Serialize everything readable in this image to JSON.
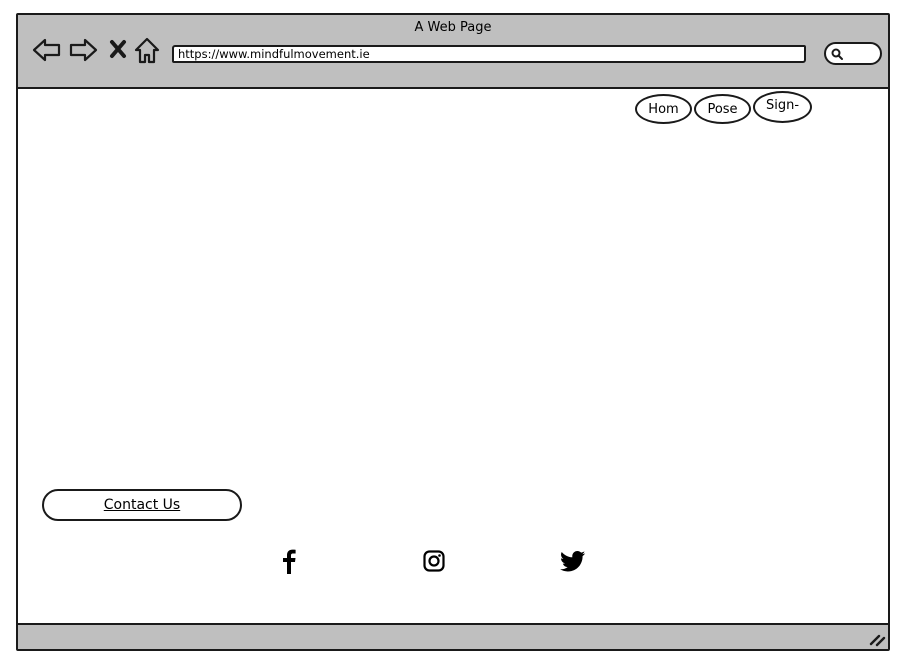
{
  "window": {
    "title": "A Web Page"
  },
  "browser": {
    "url": "https://www.mindfulmovement.ie",
    "icons": [
      "back-arrow-icon",
      "forward-arrow-icon",
      "stop-icon",
      "home-icon",
      "search-icon"
    ]
  },
  "nav": {
    "items": [
      {
        "label": "Hom"
      },
      {
        "label": "Pose"
      },
      {
        "label": "Sign-"
      }
    ]
  },
  "footer": {
    "contact_label": "Contact Us",
    "social_icons": [
      "facebook-icon",
      "instagram-icon",
      "twitter-icon"
    ]
  },
  "colors": {
    "chrome": "#bfbfbf",
    "stroke": "#1a1a1a",
    "page": "#ffffff"
  }
}
